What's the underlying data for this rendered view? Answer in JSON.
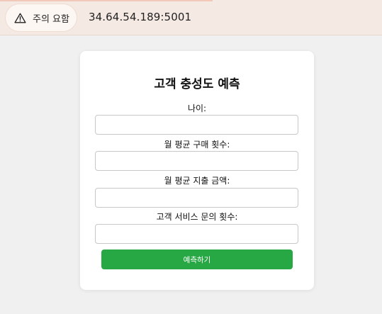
{
  "browser": {
    "security_chip_label": "주의 요함",
    "security_icon": "warning-triangle-icon",
    "url": "34.64.54.189:5001"
  },
  "form": {
    "title": "고객 충성도 예측",
    "fields": [
      {
        "label": "나이:",
        "value": ""
      },
      {
        "label": "월 평균 구매 횟수:",
        "value": ""
      },
      {
        "label": "월 평균 지출 금액:",
        "value": ""
      },
      {
        "label": "고객 서비스 문의 횟수:",
        "value": ""
      }
    ],
    "submit_label": "예측하기"
  },
  "colors": {
    "submit_button": "#28a745",
    "page_background": "#f0f0f0",
    "address_bar": "#f5e9e3"
  }
}
